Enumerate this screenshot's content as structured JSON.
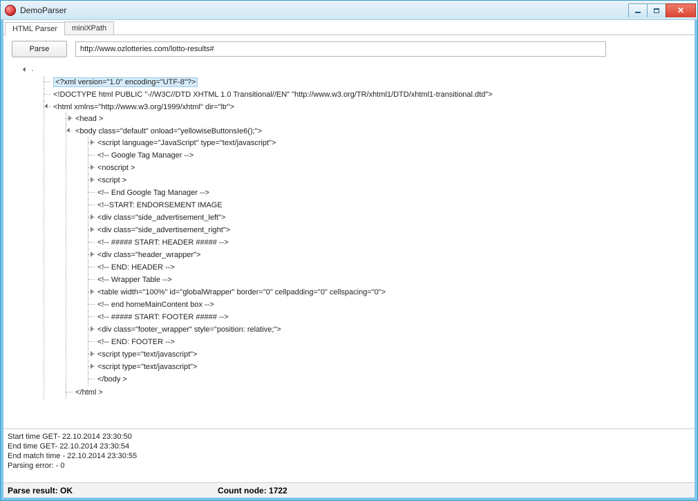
{
  "window": {
    "title": "DemoParser"
  },
  "tabs": {
    "active": "HTML Parser",
    "other": "miniXPath"
  },
  "toolbar": {
    "parse_label": "Parse",
    "url": "http://www.ozlotteries.com/lotto-results#"
  },
  "tree": {
    "n0": "<?xml version=\"1.0\" encoding=\"UTF-8\"?>",
    "n1": "<!DOCTYPE html PUBLIC \"-//W3C//DTD XHTML 1.0 Transitional//EN\" \"http://www.w3.org/TR/xhtml1/DTD/xhtml1-transitional.dtd\">",
    "n2": "<html xmlns=\"http://www.w3.org/1999/xhtml\" dir=\"ltr\">",
    "n3": "<head >",
    "n4": "<body class=\"default\"  onload=\"yellowiseButtonsIe6();\">",
    "n5": "<script language=\"JavaScript\" type=\"text/javascript\">",
    "n6": "<!-- Google Tag Manager -->",
    "n7": "<noscript >",
    "n8": "<script >",
    "n9": "<!-- End Google Tag Manager -->",
    "n10": "<!--START: ENDORSEMENT IMAGE",
    "n11": "<div class=\"side_advertisement_left\">",
    "n12": "<div class=\"side_advertisement_right\">",
    "n13": "<!-- ##### START: HEADER ##### -->",
    "n14": "<div class=\"header_wrapper\">",
    "n15": "<!-- END: HEADER -->",
    "n16": "<!-- Wrapper Table -->",
    "n17": "<table width=\"100%\" id=\"globalWrapper\" border=\"0\" cellpadding=\"0\" cellspacing=\"0\">",
    "n18": "<!-- end homeMainContent box -->",
    "n19": "<!--  ##### START: FOOTER ##### -->",
    "n20": "<div class=\"footer_wrapper\" style=\"position: relative;\">",
    "n21": "<!-- END: FOOTER -->",
    "n22": "<script type=\"text/javascript\">",
    "n23": "<script type=\"text/javascript\">",
    "n24": "</body >",
    "n25": "</html >"
  },
  "log": {
    "l0": "Start time GET- 22.10.2014 23:30:50",
    "l1": "End time GET- 22.10.2014 23:30:54",
    "l2": "End match time - 22.10.2014 23:30:55",
    "l3": "Parsing error: - 0"
  },
  "status": {
    "result": "Parse result: OK",
    "count": "Count node: 1722"
  }
}
